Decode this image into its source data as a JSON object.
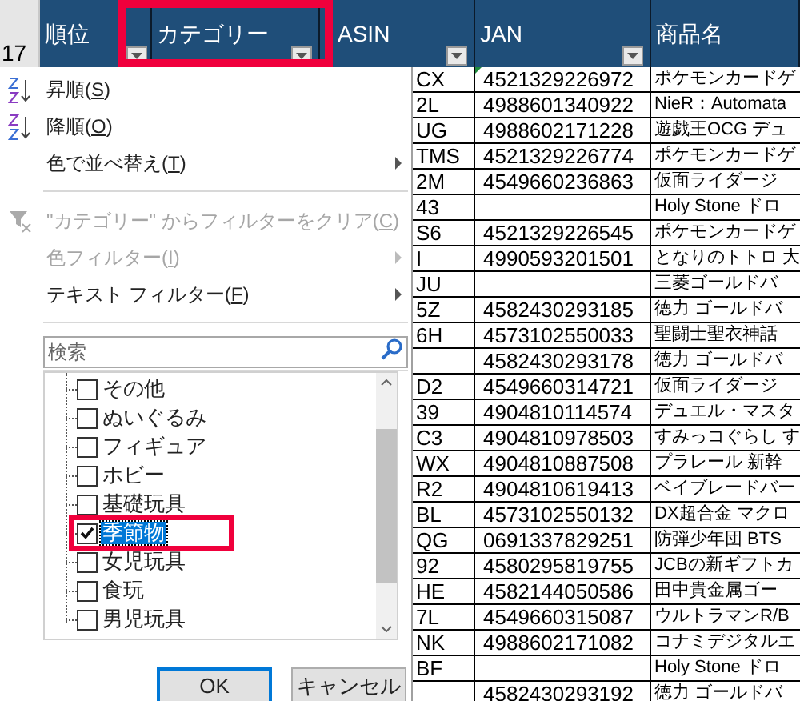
{
  "sheet": {
    "header_row_number": "17",
    "columns": [
      {
        "label": "順位",
        "filter": true,
        "highlighted": false
      },
      {
        "label": "カテゴリー",
        "filter": true,
        "highlighted": true
      },
      {
        "label": "ASIN",
        "filter": true,
        "highlighted": false
      },
      {
        "label": "JAN",
        "filter": true,
        "highlighted": false
      },
      {
        "label": "商品名",
        "filter": false,
        "highlighted": false
      }
    ],
    "rows": [
      {
        "asin": "CX",
        "jan": "4521329226972",
        "name": "ポケモンカードゲ",
        "flag": true
      },
      {
        "asin": "2L",
        "jan": "4988601340922",
        "name": "NieR：Automata",
        "flag": false
      },
      {
        "asin": "UG",
        "jan": "4988602171228",
        "name": "遊戯王OCG デュ",
        "flag": false
      },
      {
        "asin": "TMS",
        "jan": "4521329226774",
        "name": "ポケモンカードゲ",
        "flag": false
      },
      {
        "asin": "2M",
        "jan": "4549660236863",
        "name": "仮面ライダージ",
        "flag": false
      },
      {
        "asin": "43",
        "name": "Holy Stone ドロ",
        "flag": false
      },
      {
        "asin": "S6",
        "jan": "4521329226545",
        "name": "ポケモンカードゲ",
        "flag": false
      },
      {
        "asin": "I",
        "jan": "4990593201501",
        "name": "となりのトトロ 大",
        "flag": false
      },
      {
        "asin": "JU",
        "name": "三菱ゴールドバ",
        "flag": false
      },
      {
        "asin": "5Z",
        "jan": "4582430293185",
        "name": "徳力 ゴールドバ",
        "flag": false
      },
      {
        "asin": "6H",
        "jan": "4573102550033",
        "name": "聖闘士聖衣神話",
        "flag": false
      },
      {
        "jan": "4582430293178",
        "name": "徳力 ゴールドバ",
        "flag": false
      },
      {
        "asin": "D2",
        "jan": "4549660314721",
        "name": "仮面ライダージ",
        "flag": false
      },
      {
        "asin": "39",
        "jan": "4904810114574",
        "name": "デュエル・マスタ",
        "flag": false
      },
      {
        "asin": "C3",
        "jan": "4904810978503",
        "name": "すみっコぐらし す",
        "flag": false
      },
      {
        "asin": "WX",
        "jan": "4904810887508",
        "name": "プラレール 新幹",
        "flag": false
      },
      {
        "asin": "R2",
        "jan": "4904810619413",
        "name": "ベイブレードバー",
        "flag": false
      },
      {
        "asin": "BL",
        "jan": "4573102550132",
        "name": "DX超合金 マクロ",
        "flag": false
      },
      {
        "asin": "QG",
        "jan": "0691337829251",
        "name": "防弾少年団 BTS",
        "flag": false
      },
      {
        "asin": "92",
        "jan": "4580295819755",
        "name": "JCBの新ギフトカ",
        "flag": false
      },
      {
        "asin": "HE",
        "jan": "4582144050586",
        "name": "田中貴金属ゴー",
        "flag": false
      },
      {
        "asin": "7L",
        "jan": "4549660315087",
        "name": "ウルトラマンR/B",
        "flag": false
      },
      {
        "asin": "NK",
        "jan": "4988602171082",
        "name": "コナミデジタルエ",
        "flag": false
      },
      {
        "asin": "BF",
        "name": "Holy Stone ドロ",
        "flag": false
      },
      {
        "jan": "4582430293192",
        "name": "徳力 ゴールドバ",
        "flag": false
      }
    ]
  },
  "filter_menu": {
    "items": [
      {
        "kind": "sort-asc",
        "label": "昇順(S)",
        "disabled": false,
        "submenu": false
      },
      {
        "kind": "sort-desc",
        "label": "降順(O)",
        "disabled": false,
        "submenu": false
      },
      {
        "kind": "plain",
        "label": "色で並べ替え(T)",
        "disabled": false,
        "submenu": true
      },
      {
        "kind": "separator"
      },
      {
        "kind": "clear",
        "label": "\"カテゴリー\" からフィルターをクリア(C)",
        "disabled": true,
        "submenu": false
      },
      {
        "kind": "plain",
        "label": "色フィルター(I)",
        "disabled": true,
        "submenu": true
      },
      {
        "kind": "plain",
        "label": "テキスト フィルター(F)",
        "disabled": false,
        "submenu": true
      },
      {
        "kind": "separator"
      }
    ],
    "search": {
      "placeholder": "検索"
    },
    "values": [
      {
        "label": "その他",
        "checked": false,
        "selected": false,
        "highlighted": false
      },
      {
        "label": "ぬいぐるみ",
        "checked": false,
        "selected": false,
        "highlighted": false
      },
      {
        "label": "フィギュア",
        "checked": false,
        "selected": false,
        "highlighted": false
      },
      {
        "label": "ホビー",
        "checked": false,
        "selected": false,
        "highlighted": false
      },
      {
        "label": "基礎玩具",
        "checked": false,
        "selected": false,
        "highlighted": false
      },
      {
        "label": "季節物",
        "checked": true,
        "selected": true,
        "highlighted": true
      },
      {
        "label": "女児玩具",
        "checked": false,
        "selected": false,
        "highlighted": false
      },
      {
        "label": "食玩",
        "checked": false,
        "selected": false,
        "highlighted": false
      },
      {
        "label": "男児玩具",
        "checked": false,
        "selected": false,
        "highlighted": false
      }
    ],
    "buttons": [
      {
        "label": "OK",
        "default": true
      },
      {
        "label": "キャンセル",
        "default": false
      }
    ]
  }
}
